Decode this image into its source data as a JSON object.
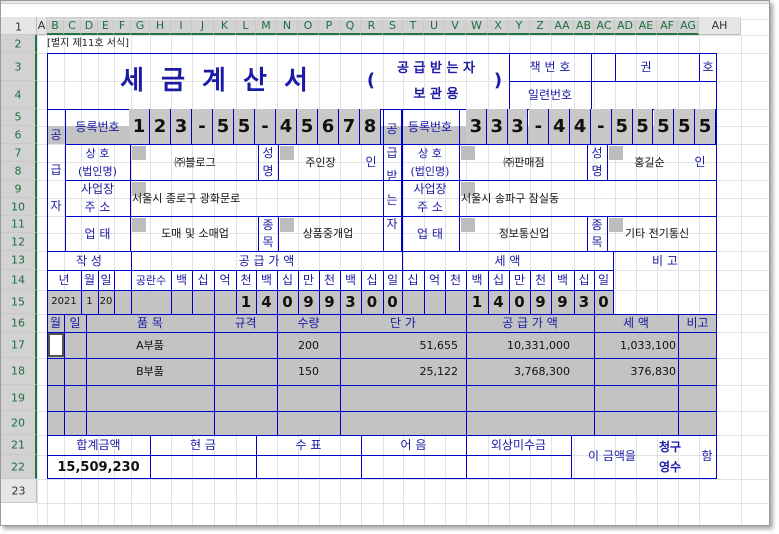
{
  "columns": [
    "A",
    "B",
    "C",
    "D",
    "E",
    "F",
    "G",
    "H",
    "I",
    "J",
    "K",
    "L",
    "M",
    "N",
    "O",
    "P",
    "Q",
    "R",
    "S",
    "T",
    "U",
    "V",
    "W",
    "X",
    "Y",
    "Z",
    "AA",
    "AB",
    "AC",
    "AD",
    "AE",
    "AF",
    "AG",
    "AH"
  ],
  "rows": [
    "1",
    "2",
    "3",
    "4",
    "5",
    "6",
    "7",
    "8",
    "9",
    "10",
    "11",
    "12",
    "13",
    "14",
    "15",
    "16",
    "17",
    "18",
    "19",
    "20",
    "21",
    "22",
    "23"
  ],
  "form_label": "[별지 제11호 서식]",
  "title": "세 금 계 산 서",
  "paren_open": "(",
  "paren_close": ")",
  "receiver_copy_1": "공 급 받 는 자",
  "receiver_copy_2": "보   관   용",
  "book_no_label": "책 번 호",
  "volume_label": "권",
  "issue_label": "호",
  "serial_no_label": "일련번호",
  "supplier": {
    "side_label": [
      "공",
      "급",
      "자"
    ],
    "reg_label": "등록번호",
    "reg_digits": [
      "1",
      "2",
      "3",
      "-",
      "5",
      "5",
      "-",
      "4",
      "5",
      "6",
      "7",
      "8"
    ],
    "name_label_1": "상   호",
    "name_label_2": "(법인명)",
    "name": "㈜블로그",
    "owner_label_1": "성",
    "owner_label_2": "명",
    "owner": "주인장",
    "seal": "인",
    "addr_label_1": "사업장",
    "addr_label_2": "주   소",
    "address": "서울시 종로구 광화문로",
    "type_label": "업   태",
    "biz_type": "도매 및 소매업",
    "item_label_1": "종",
    "item_label_2": "목",
    "biz_item": "상품중개업"
  },
  "receiver": {
    "side_label": [
      "공",
      "급",
      "받",
      "는",
      "자"
    ],
    "reg_label": "등록번호",
    "reg_digits": [
      "3",
      "3",
      "3",
      "-",
      "4",
      "4",
      "-",
      "5",
      "5",
      "5",
      "5",
      "5"
    ],
    "name_label_1": "상   호",
    "name_label_2": "(법인명)",
    "name": "㈜판매점",
    "owner_label_1": "성",
    "owner_label_2": "명",
    "owner": "홍길순",
    "seal": "인",
    "addr_label_1": "사업장",
    "addr_label_2": "주   소",
    "address": "서울시 송파구 잠실동",
    "type_label": "업   태",
    "biz_type": "정보통신업",
    "item_label_1": "종",
    "item_label_2": "목",
    "biz_item": "기타 전기통신"
  },
  "date_header": "작   성",
  "supply_header": "공   급   가   액",
  "tax_header": "세       액",
  "note_header": "비   고",
  "date_cols": [
    "년",
    "월",
    "일"
  ],
  "blank_count_label": "공란수",
  "supply_place_cols": [
    "백",
    "십",
    "억",
    "천",
    "백",
    "십",
    "만",
    "천",
    "백",
    "십",
    "일"
  ],
  "tax_place_cols": [
    "십",
    "억",
    "천",
    "백",
    "십",
    "만",
    "천",
    "백",
    "십",
    "일"
  ],
  "date_values": [
    "2021",
    "1",
    "20"
  ],
  "supply_digits": [
    "",
    "",
    "",
    "1",
    "4",
    "0",
    "9",
    "9",
    "3",
    "0",
    "0"
  ],
  "tax_digits": [
    "",
    "",
    "",
    "1",
    "4",
    "0",
    "9",
    "9",
    "3",
    "0"
  ],
  "items_header": {
    "month": "월",
    "day": "일",
    "item": "품         목",
    "spec": "규격",
    "qty": "수량",
    "unit_price": "단        가",
    "amount": "공  급  가  액",
    "tax": "세        액",
    "note": "비고"
  },
  "items": [
    {
      "name": "A부품",
      "qty": "200",
      "unit_price": "51,655",
      "amount": "10,331,000",
      "tax": "1,033,100"
    },
    {
      "name": "B부품",
      "qty": "150",
      "unit_price": "25,122",
      "amount": "3,768,300",
      "tax": "376,830"
    }
  ],
  "totals": {
    "total_label": "합계금액",
    "cash_label": "현   금",
    "check_label": "수   표",
    "note_label": "어   음",
    "credit_label": "외상미수금",
    "total_value": "15,509,230",
    "amount_text": "이 금액을",
    "claim_1": "청구",
    "claim_2": "영수",
    "end": "함"
  }
}
